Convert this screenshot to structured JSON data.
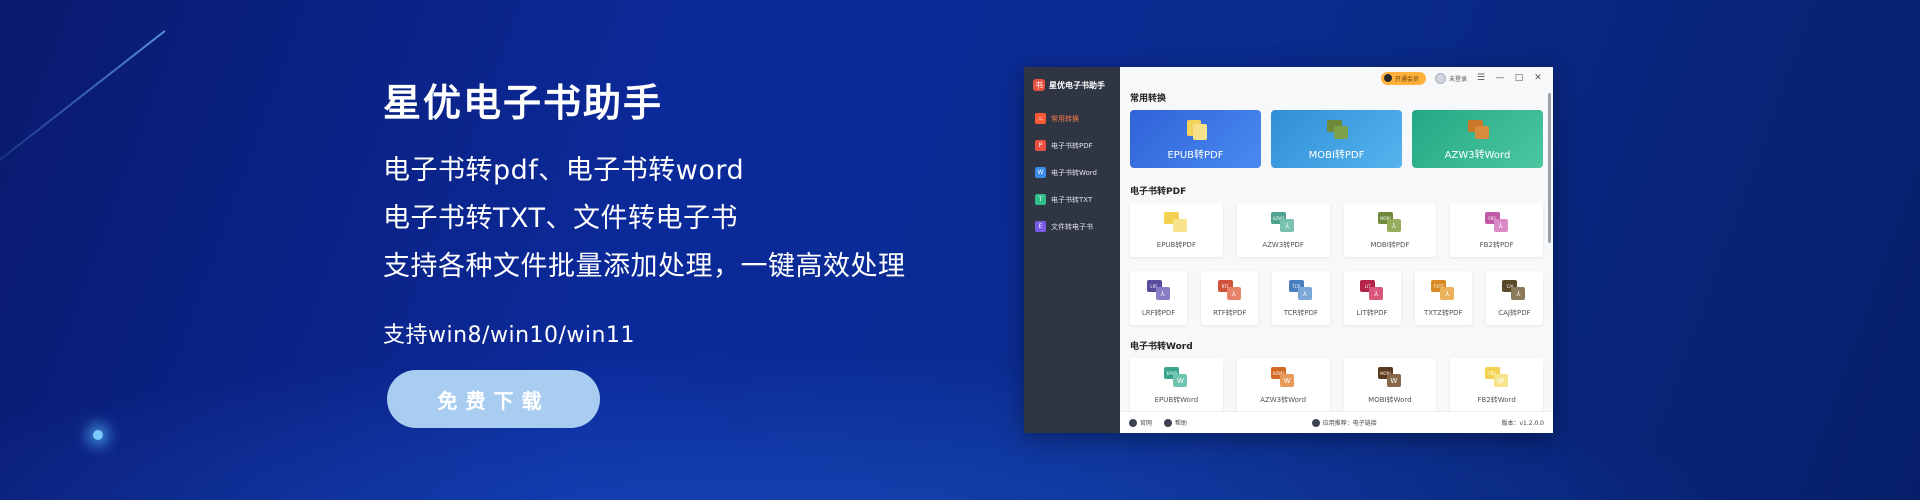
{
  "hero": {
    "title": "星优电子书助手",
    "lines": [
      "电子书转pdf、电子书转word",
      "电子书转TXT、文件转电子书",
      "支持各种文件批量添加处理，一键高效处理"
    ],
    "os": "支持win8/win10/win11",
    "download_label": "免费下载"
  },
  "app": {
    "name": "星优电子书助手",
    "vip_label": "开通会员",
    "user_label": "未登录",
    "sidebar": [
      {
        "label": "常用转换",
        "icon": "fire-icon",
        "color": "#ff5a36"
      },
      {
        "label": "电子书转PDF",
        "icon": "pdf-icon",
        "color": "#e9503f"
      },
      {
        "label": "电子书转Word",
        "icon": "word-icon",
        "color": "#3b8be8"
      },
      {
        "label": "电子书转TXT",
        "icon": "txt-icon",
        "color": "#2fbf8a"
      },
      {
        "label": "文件转电子书",
        "icon": "ebook-icon",
        "color": "#7a5be8"
      }
    ],
    "sections": {
      "common": {
        "title": "常用转换",
        "cards": [
          {
            "label": "EPUB转PDF",
            "color1": "#2f62d8",
            "color2": "#4a8bf0"
          },
          {
            "label": "MOBI转PDF",
            "color1": "#2f8fd6",
            "color2": "#56b3ee"
          },
          {
            "label": "AZW3转Word",
            "color1": "#23a884",
            "color2": "#4cc7a0"
          }
        ]
      },
      "pdf": {
        "title": "电子书转PDF",
        "row1": [
          {
            "label": "EPUB转PDF",
            "tag": "",
            "color": "#f2d24f"
          },
          {
            "label": "AZW3转PDF",
            "tag": "AZW3",
            "color": "#4fa38f"
          },
          {
            "label": "MOBI转PDF",
            "tag": "MOBI",
            "color": "#6f8a3a"
          },
          {
            "label": "FB2转PDF",
            "tag": "FB2",
            "color": "#c05aa8"
          }
        ],
        "row2": [
          {
            "label": "LRF转PDF",
            "tag": "LRF",
            "color": "#5a4c9c"
          },
          {
            "label": "RTF转PDF",
            "tag": "RTF",
            "color": "#d0533a"
          },
          {
            "label": "TCR转PDF",
            "tag": "TCR",
            "color": "#4a7fc0"
          },
          {
            "label": "LIT转PDF",
            "tag": "LIT",
            "color": "#b3234a"
          },
          {
            "label": "TXTZ转PDF",
            "tag": "TXTZ",
            "color": "#d98a22"
          },
          {
            "label": "CAJ转PDF",
            "tag": "CAJ",
            "color": "#5a4a2a"
          }
        ]
      },
      "word": {
        "title": "电子书转Word",
        "row1": [
          {
            "label": "EPUB转Word",
            "tag": "EPUB",
            "color": "#3aa58f"
          },
          {
            "label": "AZW3转Word",
            "tag": "AZW3",
            "color": "#d06a22"
          },
          {
            "label": "MOBI转Word",
            "tag": "MOBI",
            "color": "#5a3a1a"
          },
          {
            "label": "FB2转Word",
            "tag": "FB2",
            "color": "#f2d24f"
          }
        ]
      }
    },
    "bottom": {
      "website": "官网",
      "help": "帮助",
      "status": "应用推荐：电子链接",
      "version": "版本：v1.2.0.0"
    }
  }
}
